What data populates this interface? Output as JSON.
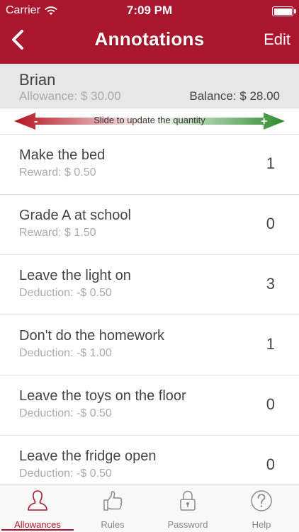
{
  "status_bar": {
    "carrier": "Carrier",
    "time": "7:09 PM"
  },
  "nav": {
    "title": "Annotations",
    "edit_label": "Edit"
  },
  "child": {
    "name": "Brian",
    "allowance": "Allowance: $ 30.00",
    "balance": "Balance: $ 28.00"
  },
  "slider": {
    "minus": "-",
    "plus": "+",
    "hint": "Slide to update the quantity"
  },
  "items": [
    {
      "task": "Make the bed",
      "detail": "Reward: $ 0.50",
      "qty": "1"
    },
    {
      "task": "Grade A at school",
      "detail": "Reward: $ 1.50",
      "qty": "0"
    },
    {
      "task": "Leave the light on",
      "detail": "Deduction: -$ 0.50",
      "qty": "3"
    },
    {
      "task": "Don't do the homework",
      "detail": "Deduction: -$ 1.00",
      "qty": "1"
    },
    {
      "task": "Leave the toys on the floor",
      "detail": "Deduction: -$ 0.50",
      "qty": "0"
    },
    {
      "task": "Leave the fridge open",
      "detail": "Deduction: -$ 0.50",
      "qty": "0"
    }
  ],
  "tabs": [
    {
      "label": "Allowances",
      "icon": "person-icon",
      "active": true
    },
    {
      "label": "Rules",
      "icon": "thumbs-up-icon",
      "active": false
    },
    {
      "label": "Password",
      "icon": "lock-icon",
      "active": false
    },
    {
      "label": "Help",
      "icon": "question-icon",
      "active": false
    }
  ],
  "colors": {
    "brand": "#a9162e",
    "minus": "#b3121f",
    "plus": "#2e8b2e"
  }
}
